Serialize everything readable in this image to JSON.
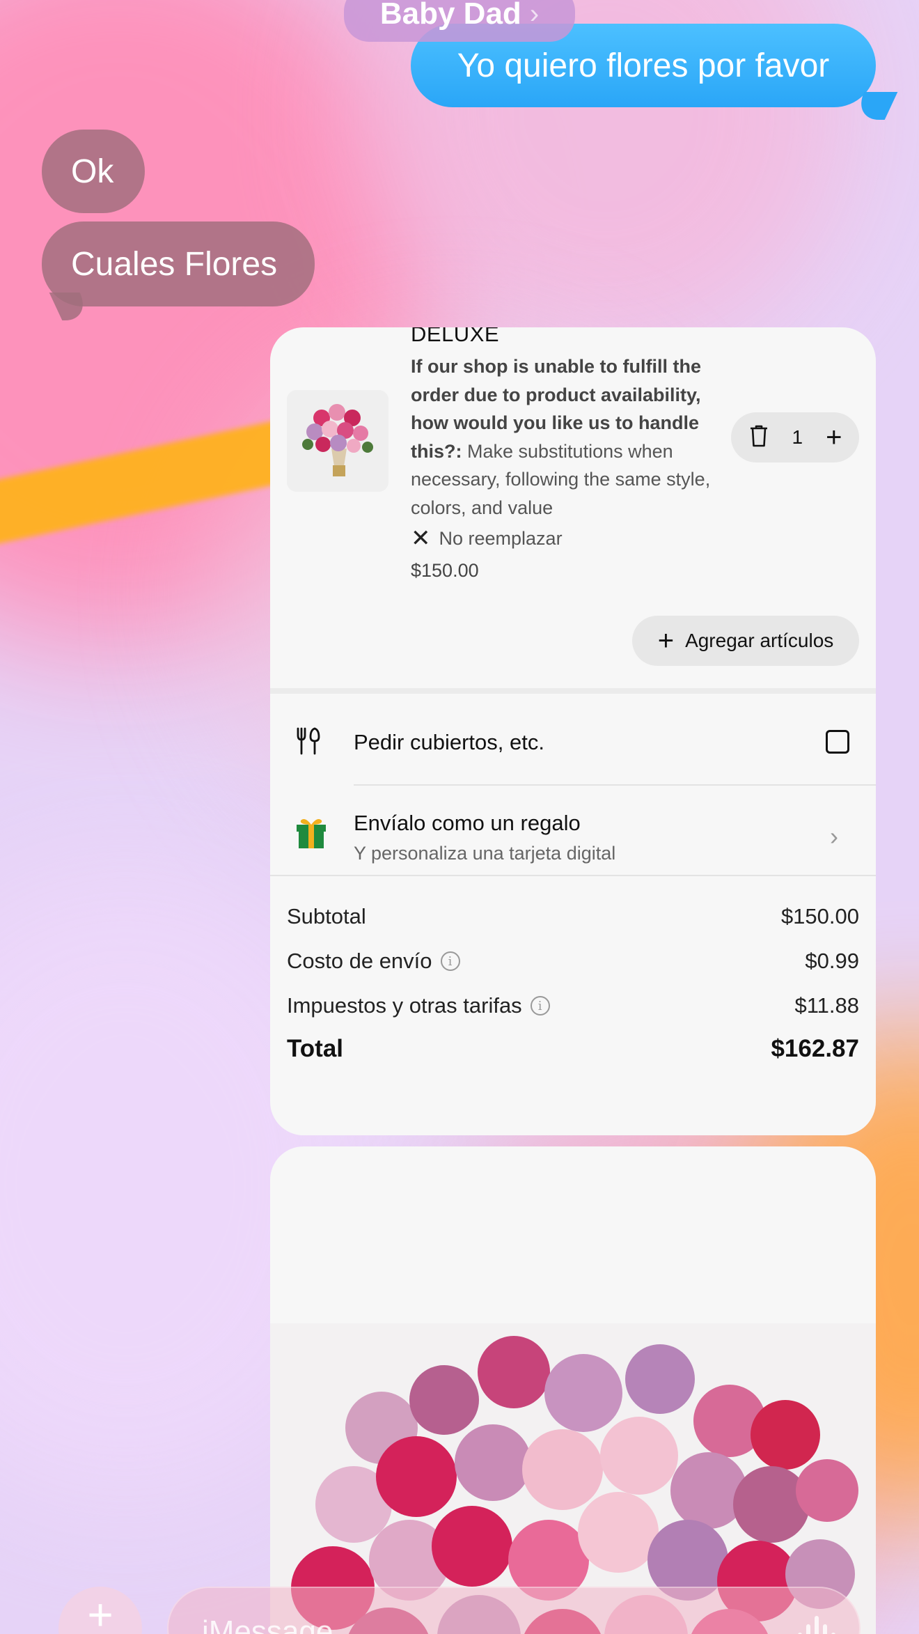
{
  "header": {
    "contact_name": "Baby Dad",
    "chevron": "›"
  },
  "messages": {
    "sent_1": "Yo quiero flores por favor",
    "received_1": "Ok",
    "received_2": "Cuales Flores"
  },
  "order": {
    "item_title": "DELUXE",
    "question_bold": "If our shop is unable to fulfill the order due to product availability, how would you like us to handle this?:",
    "question_answer": " Make substitutions when necessary, following the same style, colors, and value",
    "no_replace": "No reemplazar",
    "price": "$150.00",
    "quantity": "1",
    "add_items_label": "Agregar artículos",
    "cutlery_label": "Pedir cubiertos, etc.",
    "gift_title": "Envíalo como un regalo",
    "gift_subtitle": "Y personaliza una tarjeta digital",
    "summary": {
      "subtotal_label": "Subtotal",
      "subtotal_value": "$150.00",
      "delivery_label": "Costo de envío",
      "delivery_value": "$0.99",
      "taxes_label": "Impuestos y otras tarifas",
      "taxes_value": "$11.88",
      "total_label": "Total",
      "total_value": "$162.87"
    }
  },
  "compose": {
    "placeholder": "iMessage"
  },
  "icons": {
    "trash": "trash-icon",
    "plus": "plus-icon",
    "close": "close-icon",
    "cutlery": "cutlery-icon",
    "gift": "gift-icon",
    "info": "info-icon",
    "chevron_right": "chevron-right-icon",
    "audio": "audio-waveform-icon"
  },
  "colors": {
    "sent_bubble": "#2aa6f7",
    "card_background": "#f7f7f7"
  }
}
